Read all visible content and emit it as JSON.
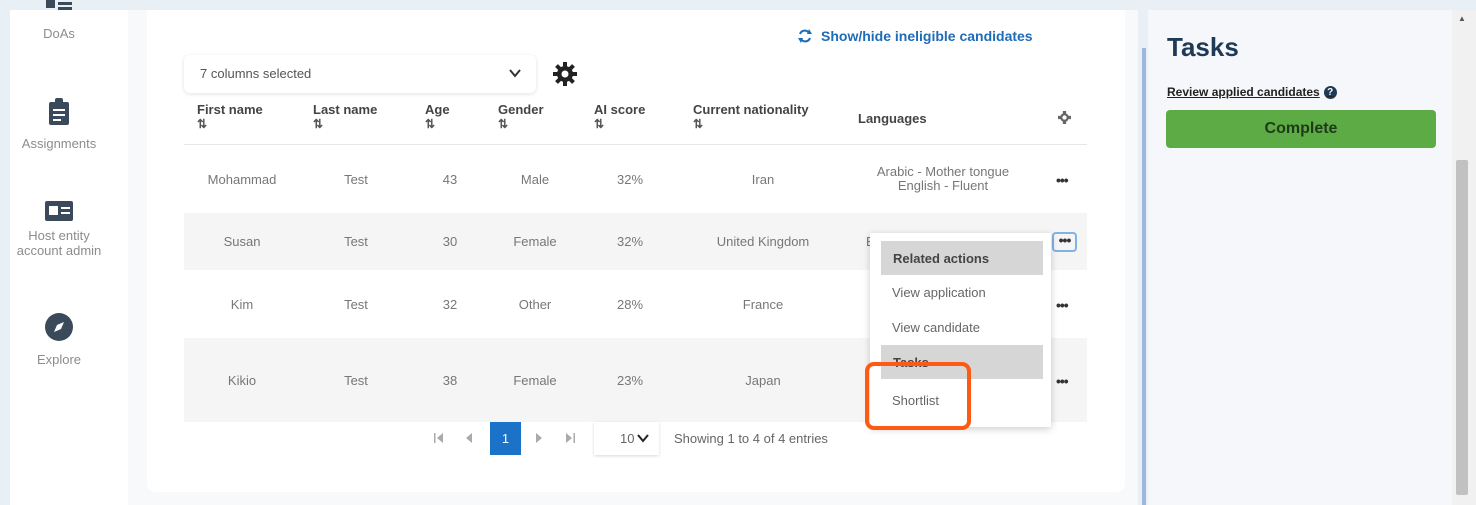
{
  "nav": {
    "items": [
      {
        "label": "DoAs",
        "icon": "doas-icon"
      },
      {
        "label": "Assignments",
        "icon": "clipboard-icon"
      },
      {
        "label": "Host entity account admin",
        "icon": "id-card-icon"
      },
      {
        "label": "Explore",
        "icon": "compass-icon"
      }
    ]
  },
  "toolbar": {
    "show_hide": "Show/hide ineligible candidates",
    "columns_selected": "7 columns selected"
  },
  "table": {
    "headers": [
      "First name",
      "Last name",
      "Age",
      "Gender",
      "AI score",
      "Current nationality",
      "Languages"
    ],
    "sort_glyph": "⇅",
    "rows": [
      {
        "first": "Mohammad",
        "last": "Test",
        "age": "43",
        "gender": "Male",
        "score": "32%",
        "nationality": "Iran",
        "lang1": "Arabic - Mother tongue",
        "lang2": "English - Fluent"
      },
      {
        "first": "Susan",
        "last": "Test",
        "age": "30",
        "gender": "Female",
        "score": "32%",
        "nationality": "United Kingdom",
        "lang1": "E",
        "lang2": ""
      },
      {
        "first": "Kim",
        "last": "Test",
        "age": "32",
        "gender": "Other",
        "score": "28%",
        "nationality": "France",
        "lang1": "",
        "lang2": ""
      },
      {
        "first": "Kikio",
        "last": "Test",
        "age": "38",
        "gender": "Female",
        "score": "23%",
        "nationality": "Japan",
        "lang1": "",
        "lang2": ""
      }
    ],
    "row_actions": "•••"
  },
  "pagination": {
    "current_page": "1",
    "page_size": "10",
    "showing": "Showing 1 to 4 of 4 entries"
  },
  "menu": {
    "related_header": "Related actions",
    "view_application": "View application",
    "view_candidate": "View candidate",
    "tasks_header": "Tasks",
    "shortlist": "Shortlist"
  },
  "tasks_panel": {
    "title": "Tasks",
    "review_link": "Review applied candidates",
    "help": "?",
    "complete": "Complete"
  },
  "colors": {
    "accent_blue": "#1e6bb8",
    "complete_green": "#5cab44",
    "highlight_orange": "#ff5a14",
    "page_active": "#1a73c8"
  }
}
